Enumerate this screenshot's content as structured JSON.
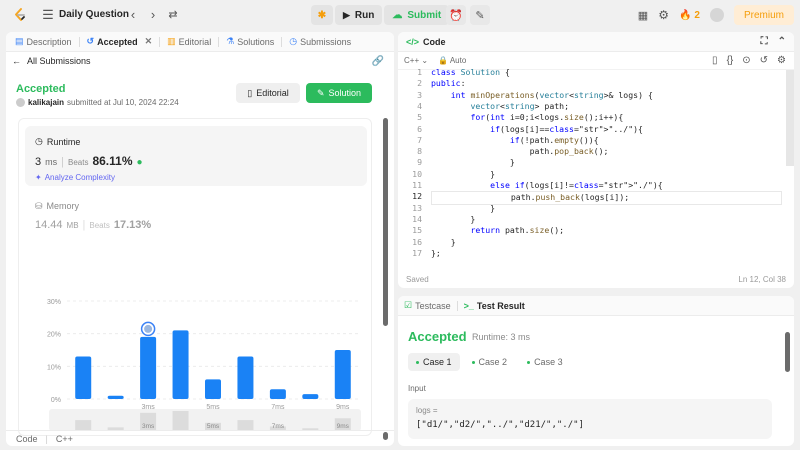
{
  "topbar": {
    "title": "Daily Question",
    "run_label": "Run",
    "submit_label": "Submit",
    "streak_count": "2",
    "premium_label": "Premium"
  },
  "left": {
    "tabs": [
      "Description",
      "Accepted",
      "Editorial",
      "Solutions",
      "Submissions"
    ],
    "all_submissions": "All Submissions",
    "status": "Accepted",
    "username": "kalikajain",
    "submitted_text": "submitted at Jul 10, 2024 22:24",
    "editorial_btn": "Editorial",
    "solution_btn": "Solution",
    "runtime_label": "Runtime",
    "runtime_value": "3",
    "runtime_unit": "ms",
    "beats_label": "Beats",
    "runtime_beats": "86.11%",
    "analyze_label": "Analyze Complexity",
    "memory_label": "Memory",
    "memory_value": "14.44",
    "memory_unit": "MB",
    "memory_beats": "17.13%",
    "footer_code": "Code",
    "footer_lang": "C++"
  },
  "chart_data": {
    "type": "bar",
    "y_ticks": [
      "30%",
      "20%",
      "10%",
      "0%"
    ],
    "ylim": [
      0,
      30
    ],
    "x_tick_labels": [
      "3ms",
      "5ms",
      "7ms",
      "9ms"
    ],
    "values": [
      13,
      1,
      19,
      21,
      6,
      13,
      3,
      1.5,
      15
    ],
    "highlight_index": 2,
    "color": "#1a82f5",
    "minimap_values": [
      12,
      4,
      20,
      22,
      9,
      12,
      5,
      3,
      14
    ],
    "minimap_labels": [
      "3ms",
      "5ms",
      "7ms",
      "9ms"
    ]
  },
  "code": {
    "header": "Code",
    "language": "C++",
    "mode": "Auto",
    "saved": "Saved",
    "cursor": "Ln 12, Col 38",
    "lines": [
      "class Solution {",
      "public:",
      "    int minOperations(vector<string>& logs) {",
      "        vector<string> path;",
      "        for(int i=0;i<logs.size();i++){",
      "            if(logs[i]==\"../\"){",
      "                if(!path.empty()){",
      "                    path.pop_back();",
      "                }",
      "            }",
      "            else if(logs[i]!=\"./\"){",
      "                path.push_back(logs[i]);",
      "            }",
      "        }",
      "        return path.size();",
      "    }",
      "};"
    ]
  },
  "test": {
    "tab_testcase": "Testcase",
    "tab_result": "Test Result",
    "status": "Accepted",
    "runtime": "Runtime: 3 ms",
    "cases": [
      "Case 1",
      "Case 2",
      "Case 3"
    ],
    "input_label": "Input",
    "var_name": "logs =",
    "var_value": "[\"d1/\",\"d2/\",\"../\",\"d21/\",\"./\"]"
  }
}
